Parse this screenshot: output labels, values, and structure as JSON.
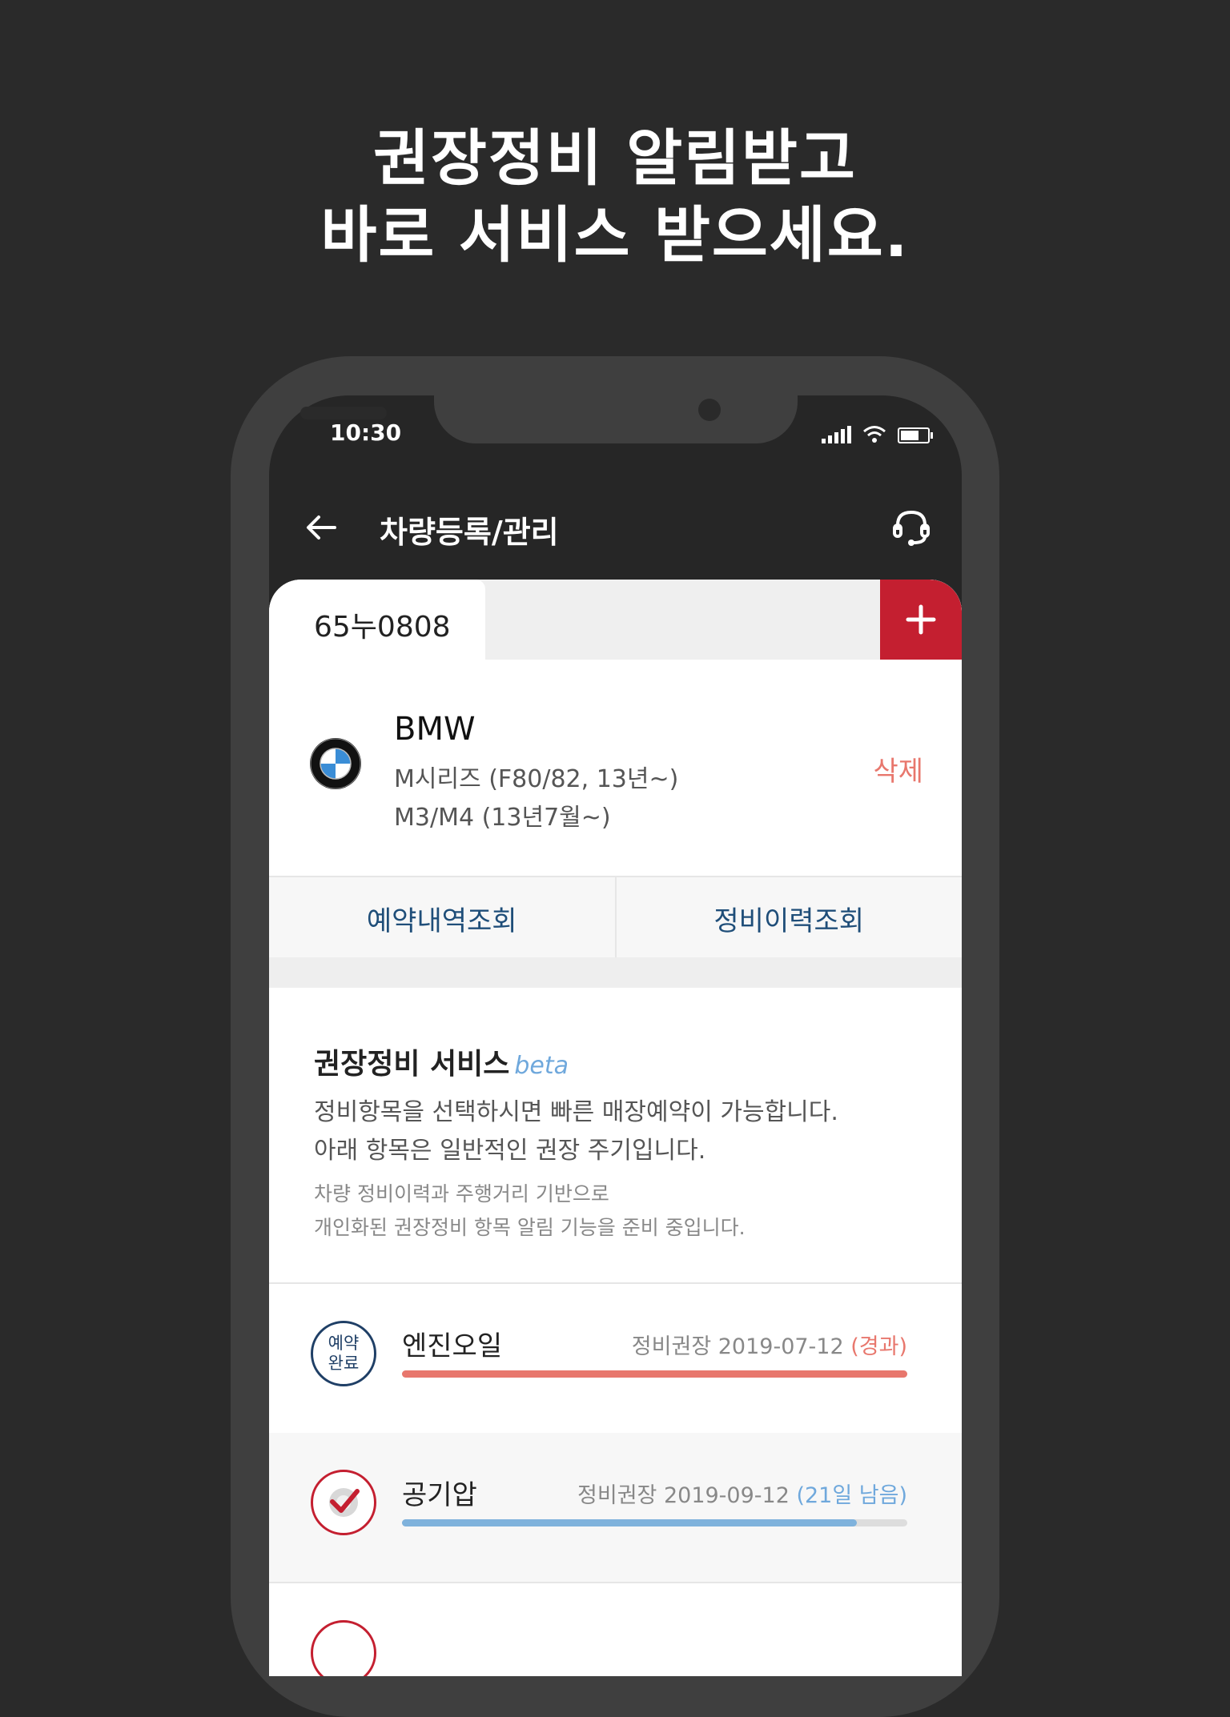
{
  "headline": [
    "권장정비 알림받고",
    "바로 서비스 받으세요."
  ],
  "status_bar": {
    "time": "10:30"
  },
  "app_bar": {
    "title": "차량등록/관리",
    "back_icon": "back-arrow-icon",
    "support_icon": "headset-icon"
  },
  "vehicle_tab": {
    "plate": "65누0808",
    "add_icon": "plus-icon"
  },
  "vehicle": {
    "brand": "BMW",
    "model_line1": "M시리즈 (F80/82, 13년~)",
    "model_line2": "M3/M4  (13년7월~)",
    "delete_label": "삭제",
    "logo": "bmw-logo"
  },
  "actions": [
    "예약내역조회",
    "정비이력조회"
  ],
  "service": {
    "title": "권장정비 서비스",
    "beta": "beta",
    "desc1": "정비항목을 선택하시면 빠른 매장예약이 가능합니다.",
    "desc2": "아래 항목은 일반적인 권장 주기입니다.",
    "note1": "차량 정비이력과 주행거리 기반으로",
    "note2": "개인화된 권장정비 항목 알림 기능을 준비 중입니다."
  },
  "items": [
    {
      "badge_line1": "예약",
      "badge_line2": "완료",
      "name": "엔진오일",
      "date_text": "정비권장 2019-07-12",
      "status_text": "(경과)",
      "status_color": "#e8776d",
      "progress": 1.0,
      "bar_color": "#e8776d",
      "background": "#ffffff"
    },
    {
      "icon": "tire-check-icon",
      "name": "공기압",
      "date_text": "정비권장 2019-09-12",
      "status_text": "(21일 남음)",
      "status_color": "#6fa8dc",
      "progress": 0.9,
      "bar_color": "#7fb2dc",
      "background": "#f7f7f7"
    }
  ],
  "colors": {
    "accent_red": "#c41f30",
    "link_blue": "#1f4e79",
    "background": "#2a2a2a"
  }
}
